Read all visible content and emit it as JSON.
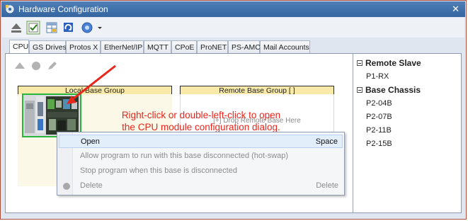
{
  "window": {
    "title": "Hardware Configuration",
    "close_glyph": "✕"
  },
  "toolbar": {
    "buttons": [
      "eject-icon",
      "checklist-icon",
      "table-icon",
      "refresh-icon",
      "help-icon",
      "dropdown-arrow-icon"
    ]
  },
  "tabs": [
    "CPU",
    "GS Drives",
    "Protos X",
    "EtherNet/IP",
    "MQTT",
    "CPoE",
    "ProNET",
    "PS-AMC",
    "Mail Accounts"
  ],
  "active_tab": "CPU",
  "groups": {
    "local": "Local Base Group",
    "remote": "Remote Base Group [ ]",
    "remote_hint": "[+] Drop Remote Base Here"
  },
  "annotation": {
    "line1": "Right-click or double-left-click to open",
    "line2": "the CPU module configuration dialog.",
    "color": "#e8261c"
  },
  "tree": {
    "remote_slave": {
      "label": "Remote Slave",
      "items": [
        "P1-RX"
      ]
    },
    "base_chassis": {
      "label": "Base Chassis",
      "items": [
        "P2-04B",
        "P2-07B",
        "P2-11B",
        "P2-15B"
      ]
    }
  },
  "context_menu": {
    "items": [
      {
        "label": "Open",
        "shortcut": "Space",
        "enabled": true,
        "highlighted": true
      },
      {
        "label": "Allow program to run with this base disconnected (hot-swap)",
        "shortcut": "",
        "enabled": false
      },
      {
        "label": "Stop program when this base is disconnected",
        "shortcut": "",
        "enabled": false
      },
      {
        "label": "Delete",
        "shortcut": "Delete",
        "enabled": false
      }
    ]
  },
  "colors": {
    "titlebar": "#3d6ca6",
    "group_header": "#f8e9a8",
    "selection_border": "#28b63a",
    "annotation": "#e8261c"
  }
}
